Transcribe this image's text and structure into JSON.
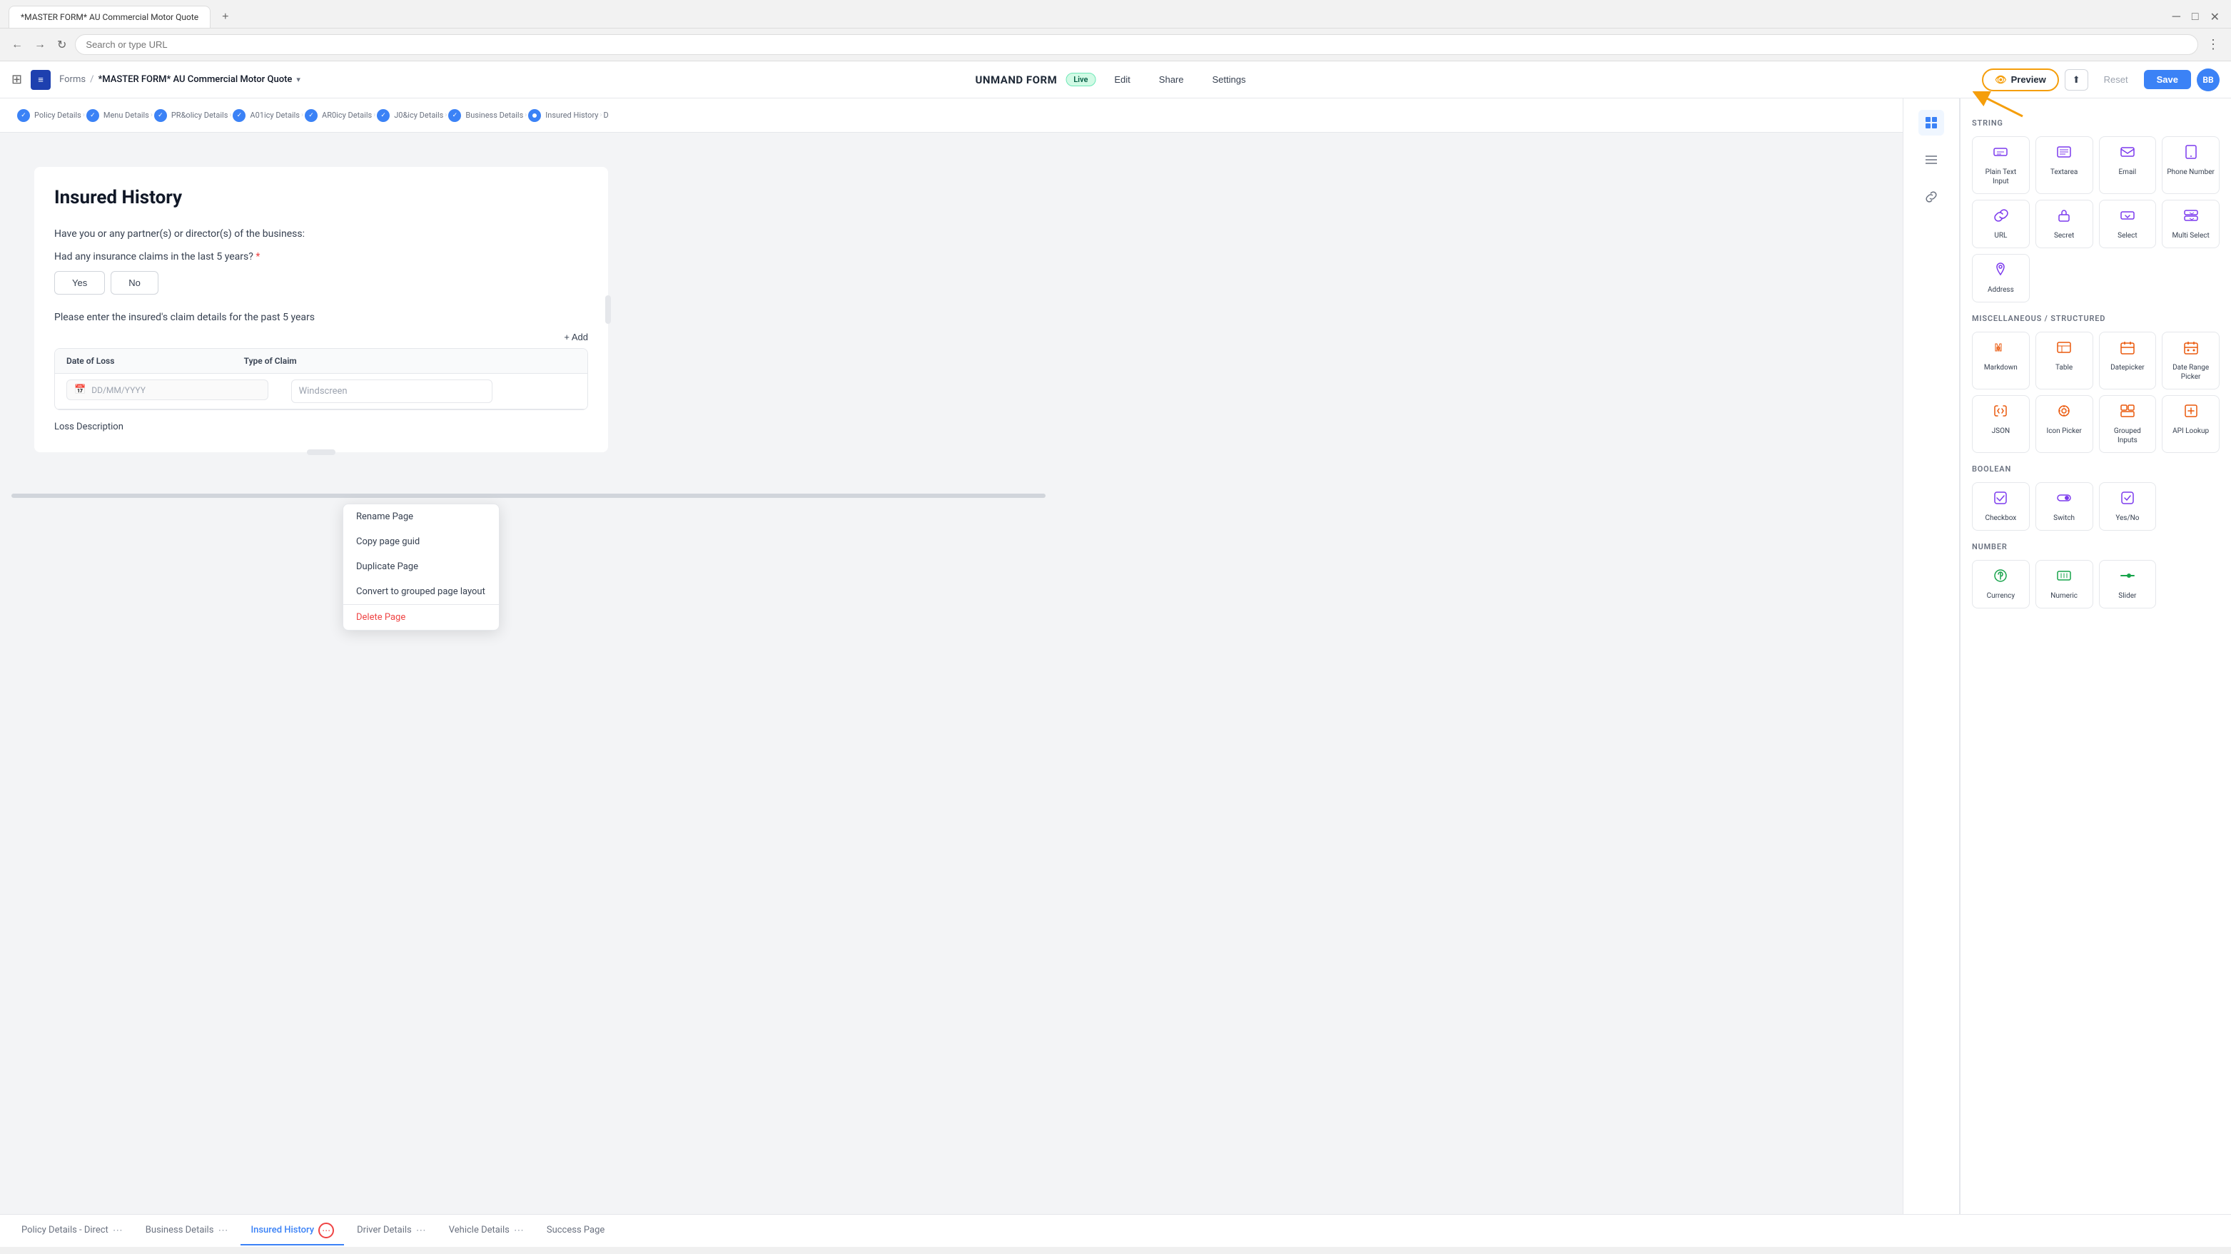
{
  "browser": {
    "tab_label": "*MASTER FORM* AU Commercial Motor Quote",
    "url": "",
    "add_tab": "+",
    "more_options": "⋮"
  },
  "header": {
    "app_name": "Forms",
    "breadcrumb_sep": "/",
    "form_title_full": "*MASTER FORM* AU Commercial Motor Quote",
    "form_title_short": "UNMAND FORM",
    "live_badge": "Live",
    "edit_btn": "Edit",
    "share_btn": "Share",
    "settings_btn": "Settings",
    "preview_btn": "Preview",
    "reset_btn": "Reset",
    "save_btn": "Save",
    "avatar": "BB"
  },
  "steps": [
    "Policy Details",
    "Menu Details",
    "PR&olicy Details",
    "A01icy Details",
    "AR0icy Details",
    "J0&icy Details",
    "Business Details",
    "Insured History",
    "D"
  ],
  "form": {
    "page_title": "Insured History",
    "description": "Have you or any partner(s) or director(s) of the business:",
    "question": "Had any insurance claims in the last 5 years?",
    "required": true,
    "yes_btn": "Yes",
    "no_btn": "No",
    "sub_label": "Please enter the insured's claim details for the past 5 years",
    "add_btn": "+ Add",
    "table": {
      "headers": [
        "Date of Loss",
        "Type of Claim",
        ""
      ],
      "date_placeholder": "DD/MM/YYYY",
      "type_placeholder": "Windscreen"
    },
    "loss_description_label": "Loss Description"
  },
  "context_menu": {
    "items": [
      {
        "label": "Rename Page",
        "danger": false
      },
      {
        "label": "Copy page guid",
        "danger": false
      },
      {
        "label": "Duplicate Page",
        "danger": false
      },
      {
        "label": "Convert to grouped page layout",
        "danger": false
      },
      {
        "label": "Delete Page",
        "danger": true
      }
    ]
  },
  "components": {
    "string_label": "String",
    "miscellaneous_label": "Miscellaneous / Structured",
    "boolean_label": "Boolean",
    "number_label": "Number",
    "items": [
      {
        "id": "plain-text-input",
        "label": "Plain Text Input",
        "icon": "▭",
        "color": "purple"
      },
      {
        "id": "textarea",
        "label": "Textarea",
        "icon": "▤",
        "color": "purple"
      },
      {
        "id": "email",
        "label": "Email",
        "icon": "✉",
        "color": "purple"
      },
      {
        "id": "phone-number",
        "label": "Phone Number",
        "icon": "📞",
        "color": "purple"
      },
      {
        "id": "url",
        "label": "URL",
        "icon": "🔗",
        "color": "purple"
      },
      {
        "id": "secret",
        "label": "Secret",
        "icon": "▭",
        "color": "purple"
      },
      {
        "id": "select",
        "label": "Select",
        "icon": "⌃",
        "color": "purple"
      },
      {
        "id": "multi-select",
        "label": "Multi Select",
        "icon": "⌃",
        "color": "purple"
      },
      {
        "id": "address",
        "label": "Address",
        "icon": "📍",
        "color": "purple"
      },
      {
        "id": "markdown",
        "label": "Markdown",
        "icon": "</>",
        "color": "orange"
      },
      {
        "id": "table",
        "label": "Table",
        "icon": "▦",
        "color": "orange"
      },
      {
        "id": "datepicker",
        "label": "Datepicker",
        "icon": "📅",
        "color": "orange"
      },
      {
        "id": "date-range-picker",
        "label": "Date Range Picker",
        "icon": "📅",
        "color": "orange"
      },
      {
        "id": "json",
        "label": "JSON",
        "icon": "</>",
        "color": "orange"
      },
      {
        "id": "icon-picker",
        "label": "Icon Picker",
        "icon": "◎",
        "color": "orange"
      },
      {
        "id": "grouped-inputs",
        "label": "Grouped Inputs",
        "icon": "⊞",
        "color": "orange"
      },
      {
        "id": "api-lookup",
        "label": "API Lookup",
        "icon": "⬆",
        "color": "orange"
      },
      {
        "id": "checkbox",
        "label": "Checkbox",
        "icon": "☑",
        "color": "purple"
      },
      {
        "id": "switch",
        "label": "Switch",
        "icon": "⊙",
        "color": "purple"
      },
      {
        "id": "yes-no",
        "label": "Yes/No",
        "icon": "✓",
        "color": "purple"
      },
      {
        "id": "currency",
        "label": "Currency",
        "icon": "$",
        "color": "green"
      },
      {
        "id": "numeric",
        "label": "Numeric",
        "icon": "⊞",
        "color": "green"
      },
      {
        "id": "slider",
        "label": "Slider",
        "icon": "⊟",
        "color": "green"
      }
    ]
  },
  "tab_bar": {
    "tabs": [
      {
        "label": "Policy Details - Direct",
        "has_dots": true,
        "active": false
      },
      {
        "label": "Business Details",
        "has_dots": true,
        "active": false
      },
      {
        "label": "Insured History",
        "has_dots": true,
        "active": true
      },
      {
        "label": "Driver Details",
        "has_dots": true,
        "active": false
      },
      {
        "label": "Vehicle Details",
        "has_dots": true,
        "active": false
      },
      {
        "label": "Success Page",
        "has_dots": false,
        "active": false
      }
    ]
  },
  "icons": {
    "grid": "⊞",
    "layers": "≡",
    "eye": "👁",
    "component": "□",
    "link": "⇄"
  }
}
